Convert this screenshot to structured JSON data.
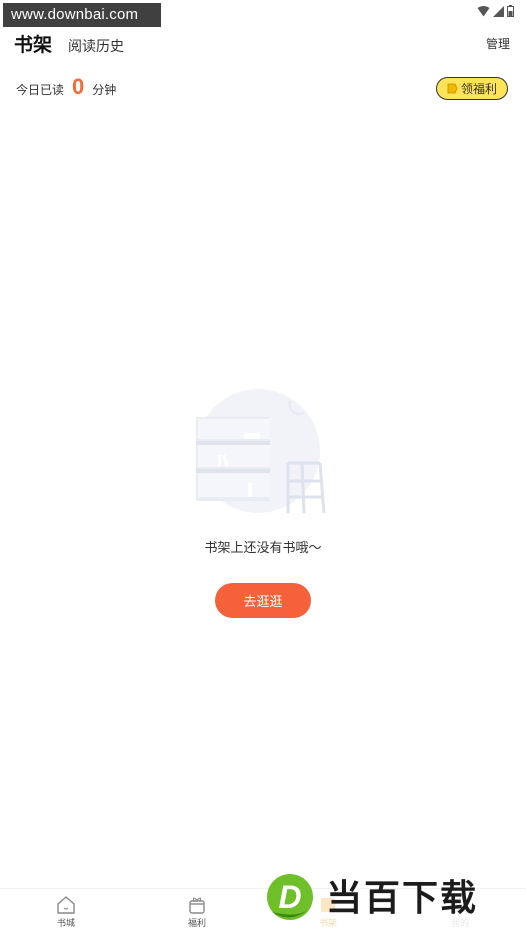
{
  "watermark": {
    "top_text": "www.downbai.com",
    "logo_text": "当百下载",
    "logo_letter": "D"
  },
  "header": {
    "tab_bookshelf": "书架",
    "tab_history": "阅读历史",
    "manage": "管理"
  },
  "reading": {
    "prefix": "今日已读",
    "minutes": "0",
    "unit": "分钟"
  },
  "welfare_button": {
    "label": "领福利"
  },
  "empty_state": {
    "message": "书架上还没有书哦～",
    "action_label": "去逛逛"
  },
  "bottom_nav": [
    {
      "label": "书城",
      "icon": "home-icon"
    },
    {
      "label": "福利",
      "icon": "gift-icon"
    },
    {
      "label": "书架",
      "icon": "bookshelf-icon"
    },
    {
      "label": "我的",
      "icon": "profile-icon"
    }
  ],
  "colors": {
    "accent": "#f5613a",
    "reading_count": "#f26a36",
    "welfare_bg": "#ffe45a"
  }
}
